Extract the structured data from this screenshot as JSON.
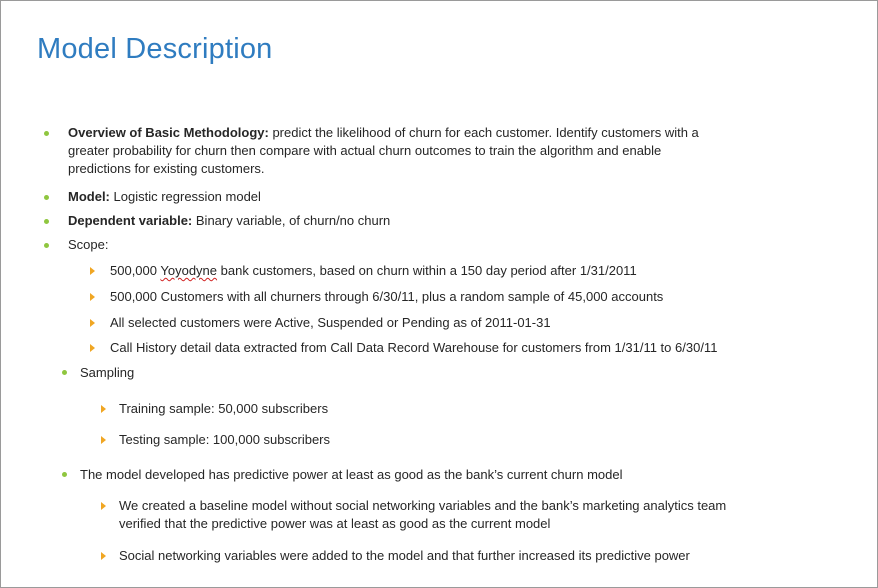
{
  "title": "Model Description",
  "overview": {
    "label": "Overview of Basic Methodology:",
    "line1": "predict the likelihood of churn for each customer. Identify customers with a",
    "line2": "greater probability for churn then compare with actual churn outcomes to train the algorithm and enable",
    "line3": "predictions for existing customers."
  },
  "model": {
    "label": "Model:",
    "text": "Logistic regression model"
  },
  "dependent": {
    "label": "Dependent variable:",
    "text": "Binary variable, of churn/no churn"
  },
  "scope": {
    "label": "Scope:",
    "items": [
      {
        "pre": "500,000",
        "flagged": "Yoyodyne",
        "post": "bank customers, based on churn within a 150 day period after 1/31/2011"
      },
      {
        "text": "500,000  Customers with all churners through 6/30/11, plus a random sample of 45,000  accounts"
      },
      {
        "text": "All selected customers were Active, Suspended or Pending as of 2011-01-31"
      },
      {
        "text": "Call History detail data extracted from Call Data Record Warehouse for customers from 1/31/11  to 6/30/11"
      }
    ]
  },
  "sampling": {
    "label": "Sampling",
    "items": [
      "Training sample:   50,000  subscribers",
      "Testing sample:  100,000  subscribers"
    ]
  },
  "predictive": {
    "label": "The model developed has predictive power at least as good as the bank’s current churn model",
    "item1_line1": "We created a baseline model without social networking variables and the bank’s marketing analytics team",
    "item1_line2": "verified that the predictive power was at least as good as the current model",
    "item2": "Social networking variables were added to the model and that further increased its predictive power"
  },
  "colors": {
    "title": "#2f7cc0",
    "bullet_level1": "#8fc63f",
    "bullet_level2": "#f0a623",
    "spellcheck": "#d02020"
  }
}
